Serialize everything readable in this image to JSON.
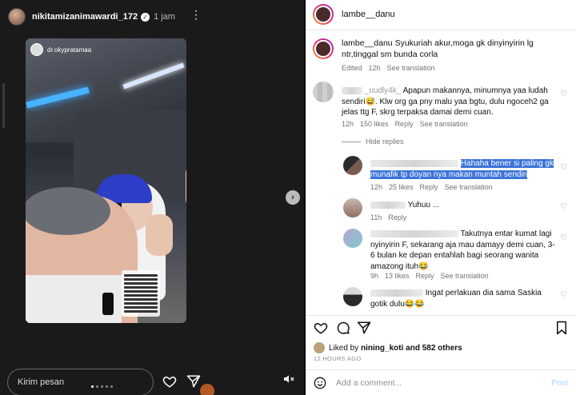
{
  "story": {
    "username": "nikitamizanimawardi_172",
    "time": "1 jam",
    "tag_name": "dr.okypratamaa",
    "message_placeholder": "Kirim pesan"
  },
  "post": {
    "username": "lambe__danu",
    "caption_user": "lambe__danu",
    "caption_text": "Syukuriah akur,moga gk dinyinyirin lg ntr,tinggal sm bunda corla",
    "caption_edited": "Edited",
    "caption_age": "12h",
    "see_translation": "See translation",
    "comments": [
      {
        "username_partial": "_uudly4k_",
        "text": "Apapun makannya, minumnya yaa ludah sendiri😅. Klw org ga pny malu yaa bgtu, dulu ngoceh2 ga jelas ttg F, skrg terpaksa damai demi cuan.",
        "age": "12h",
        "likes": "150 likes",
        "reply": "Reply",
        "translate": "See translation"
      }
    ],
    "hide_replies": "Hide replies",
    "replies": [
      {
        "text": "Hahaha bener si paling gk munafik tp doyan nya makan muntah sendiri",
        "age": "12h",
        "likes": "25 likes",
        "reply": "Reply",
        "translate": "See translation"
      },
      {
        "text": "Yuhuu ...",
        "age": "11h",
        "reply": "Reply"
      },
      {
        "text": "Takutnya entar kumat lagi nyinyirin F, sekarang aja mau damayy demi cuan, 3-6 bulan ke depan entahlah bagi seorang wanita amazong ituh😂",
        "age": "9h",
        "likes": "13 likes",
        "reply": "Reply",
        "translate": "See translation"
      },
      {
        "text": "Ingat perlakuan dia sama Saskia gotik dulu😂😂"
      }
    ],
    "liked_by_prefix": "Liked by",
    "liked_by_user": "nining_koti",
    "liked_by_suffix": "and 582 others",
    "post_time": "12 HOURS AGO",
    "add_comment_placeholder": "Add a comment...",
    "post_label": "Post"
  }
}
